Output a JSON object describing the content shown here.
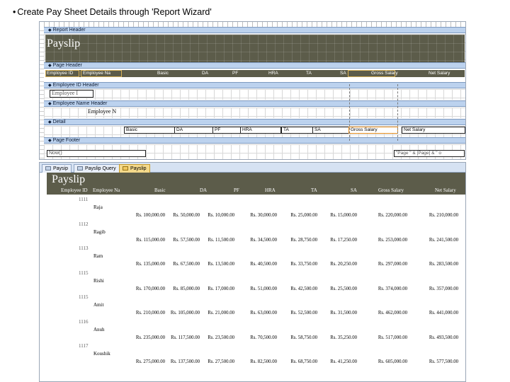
{
  "slide_title": "Create Pay Sheet Details through 'Report Wizard'",
  "design": {
    "sections": {
      "report_header": "Report Header",
      "page_header": "Page Header",
      "employee_id_header": "Employee ID Header",
      "employee_name_header": "Employee Name Header",
      "detail": "Detail",
      "page_footer": "Page Footer"
    },
    "report_title": "Payslip",
    "page_header_labels": [
      "Employee ID",
      "Employee Na",
      "Basic",
      "DA",
      "PF",
      "HRA",
      "TA",
      "SA",
      "Gross Salary",
      "Net Salary"
    ],
    "employee_id_field": "Employee I",
    "employee_name_field": "Employee N",
    "detail_fields": [
      "Basic",
      "DA",
      "PF",
      "HRA",
      "TA",
      "SA",
      "Gross Salary",
      "Net Salary"
    ],
    "footer_left": "Now()",
    "footer_right": "\"Page \" & [Page] & \" o"
  },
  "tabs": [
    {
      "label": "Paysip",
      "active": false
    },
    {
      "label": "Payslip Query",
      "active": false
    },
    {
      "label": "Payslip",
      "active": true
    }
  ],
  "report": {
    "title": "Payslip",
    "column_headers": [
      "Employee ID",
      "Employee Na",
      "Basic",
      "DA",
      "PF",
      "HRA",
      "TA",
      "SA",
      "Gross Salary",
      "Net Salary"
    ],
    "employees": [
      {
        "id": "1111",
        "name": "Raja",
        "values": [
          "Rs. 100,000.00",
          "Rs. 50,000.00",
          "Rs. 10,000.00",
          "Rs. 30,000.00",
          "Rs. 25,000.00",
          "Rs. 15,000.00",
          "Rs. 220,000.00",
          "Rs. 210,000.00"
        ]
      },
      {
        "id": "1112",
        "name": "Ragib",
        "values": [
          "Rs. 115,000.00",
          "Rs. 57,500.00",
          "Rs. 11,500.00",
          "Rs. 34,500.00",
          "Rs. 28,750.00",
          "Rs. 17,250.00",
          "Rs. 253,000.00",
          "Rs. 241,500.00"
        ]
      },
      {
        "id": "1113",
        "name": "Ram",
        "values": [
          "Rs. 135,000.00",
          "Rs. 67,500.00",
          "Rs. 13,500.00",
          "Rs. 40,500.00",
          "Rs. 33,750.00",
          "Rs. 20,250.00",
          "Rs. 297,000.00",
          "Rs. 283,500.00"
        ]
      },
      {
        "id": "1115",
        "name": "Rishi",
        "values": [
          "Rs. 170,000.00",
          "Rs. 85,000.00",
          "Rs. 17,000.00",
          "Rs. 51,000.00",
          "Rs. 42,500.00",
          "Rs. 25,500.00",
          "Rs. 374,000.00",
          "Rs. 357,000.00"
        ]
      },
      {
        "id": "1115",
        "name": "Amit",
        "values": [
          "Rs. 210,000.00",
          "Rs. 105,000.00",
          "Rs. 21,000.00",
          "Rs. 63,000.00",
          "Rs. 52,500.00",
          "Rs. 31,500.00",
          "Rs. 462,000.00",
          "Rs. 441,000.00"
        ]
      },
      {
        "id": "1116",
        "name": "Anuh",
        "values": [
          "Rs. 235,000.00",
          "Rs. 117,500.00",
          "Rs. 23,500.00",
          "Rs. 70,500.00",
          "Rs. 58,750.00",
          "Rs. 35,250.00",
          "Rs. 517,000.00",
          "Rs. 493,500.00"
        ]
      },
      {
        "id": "1117",
        "name": "Koushik",
        "values": [
          "Rs. 275,000.00",
          "Rs. 137,500.00",
          "Rs. 27,500.00",
          "Rs. 82,500.00",
          "Rs. 68,750.00",
          "Rs. 41,250.00",
          "Rs. 605,000.00",
          "Rs. 577,500.00"
        ]
      }
    ]
  },
  "colors": {
    "header_band": "#5c5c4a",
    "section_bar": "#bcd2ee",
    "active_tab": "#f4d98a",
    "selected_field": "#e08a1e"
  }
}
